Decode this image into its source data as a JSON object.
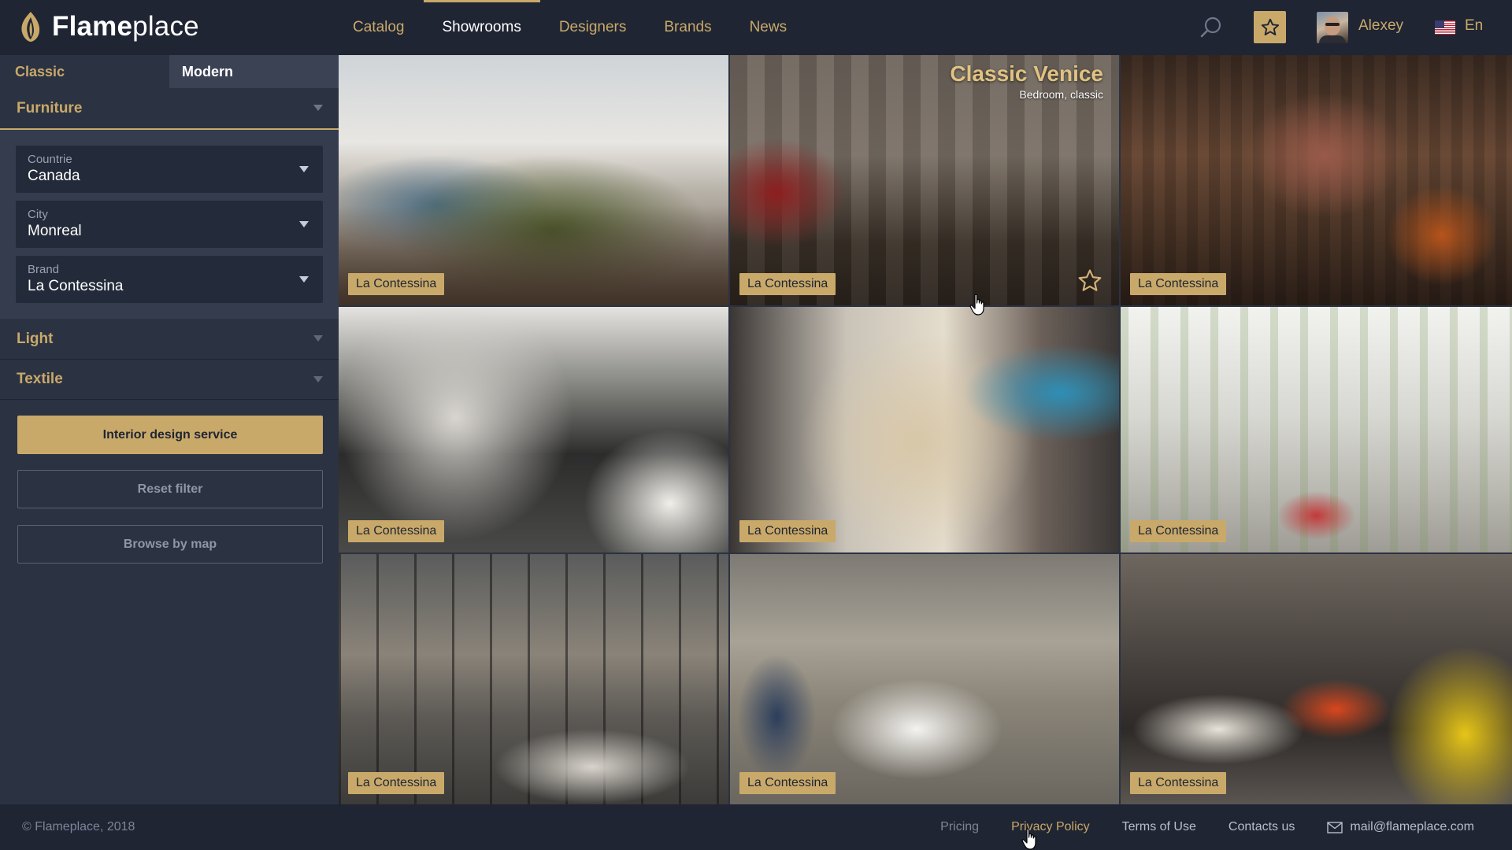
{
  "brand": {
    "name_bold": "Flame",
    "name_light": "place"
  },
  "nav": {
    "items": [
      "Catalog",
      "Showrooms",
      "Designers",
      "Brands",
      "News"
    ],
    "active": "Showrooms"
  },
  "user": {
    "name": "Alexey",
    "language": "En"
  },
  "sidebar": {
    "style_tabs": {
      "classic": "Classic",
      "modern": "Modern"
    },
    "furniture": "Furniture",
    "filters": {
      "country": {
        "label": "Countrie",
        "value": "Canada"
      },
      "city": {
        "label": "City",
        "value": "Monreal"
      },
      "brand": {
        "label": "Brand",
        "value": "La Contessina"
      }
    },
    "light": "Light",
    "textile": "Textile",
    "buttons": {
      "interior": "Interior design service",
      "reset": "Reset filter",
      "map": "Browse by map"
    }
  },
  "grid": {
    "tiles": [
      {
        "brand": "La Contessina"
      },
      {
        "brand": "La Contessina",
        "title": "Classic Venice",
        "subtitle": "Bedroom, classic"
      },
      {
        "brand": "La Contessina"
      },
      {
        "brand": "La Contessina"
      },
      {
        "brand": "La Contessina"
      },
      {
        "brand": "La Contessina"
      },
      {
        "brand": "La Contessina"
      },
      {
        "brand": "La Contessina"
      },
      {
        "brand": "La Contessina"
      }
    ]
  },
  "footer": {
    "copyright": "© Flameplace, 2018",
    "links": [
      "Pricing",
      "Privacy Policy",
      "Terms of Use",
      "Contacts us"
    ],
    "email": "mail@flameplace.com"
  },
  "colors": {
    "accent": "#c9a96a",
    "header_bg": "#1f2533",
    "sidebar_bg": "#2b3242",
    "input_bg": "#232a39"
  },
  "icons": [
    "flame-logo",
    "search-icon",
    "star-icon",
    "us-flag",
    "mail-icon",
    "caret-down-icon",
    "hand-cursor"
  ]
}
